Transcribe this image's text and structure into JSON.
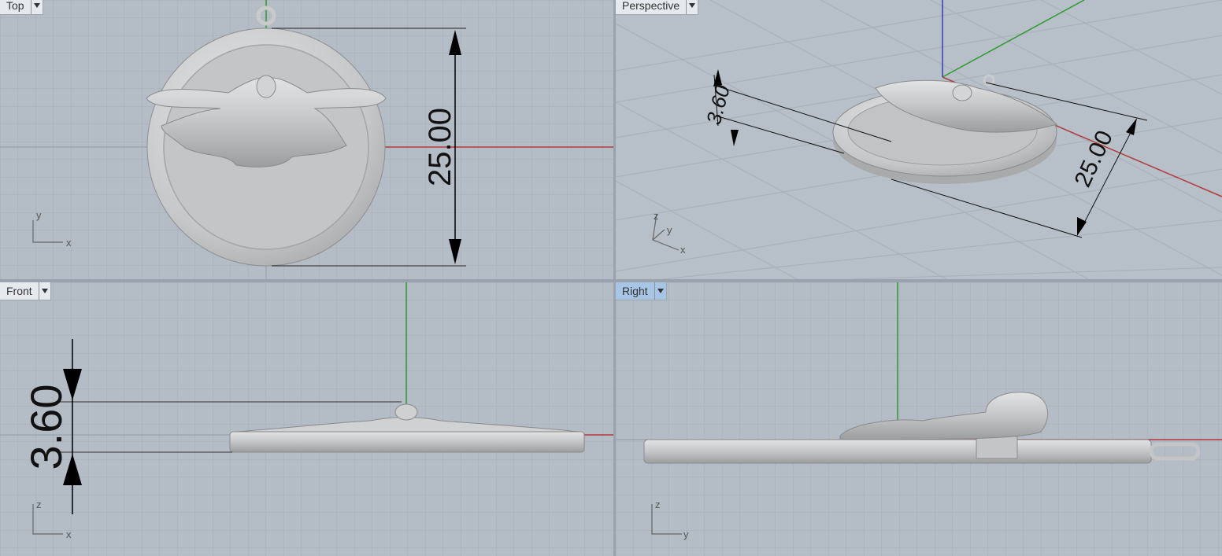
{
  "viewports": {
    "top": {
      "label": "Top"
    },
    "perspective": {
      "label": "Perspective"
    },
    "front": {
      "label": "Front"
    },
    "right": {
      "label": "Right"
    }
  },
  "dimensions": {
    "diameter": "25.00",
    "thickness": "3.60"
  },
  "axis_labels": {
    "top": {
      "v": "y",
      "h": "x"
    },
    "perspective": {
      "z": "z",
      "y": "y",
      "x": "x"
    },
    "front": {
      "v": "z",
      "h": "x"
    },
    "right": {
      "v": "z",
      "h": "y"
    }
  },
  "colors": {
    "grid_bg": "#b4bcc6",
    "grid_minor": "#a8b0ba",
    "grid_major": "#949ca6",
    "x_axis": "#b23a3a",
    "y_axis": "#2f9a2f",
    "z_axis": "#3a3ab8",
    "model": "#c9cacb",
    "active_tab": "#a9c5e6"
  }
}
